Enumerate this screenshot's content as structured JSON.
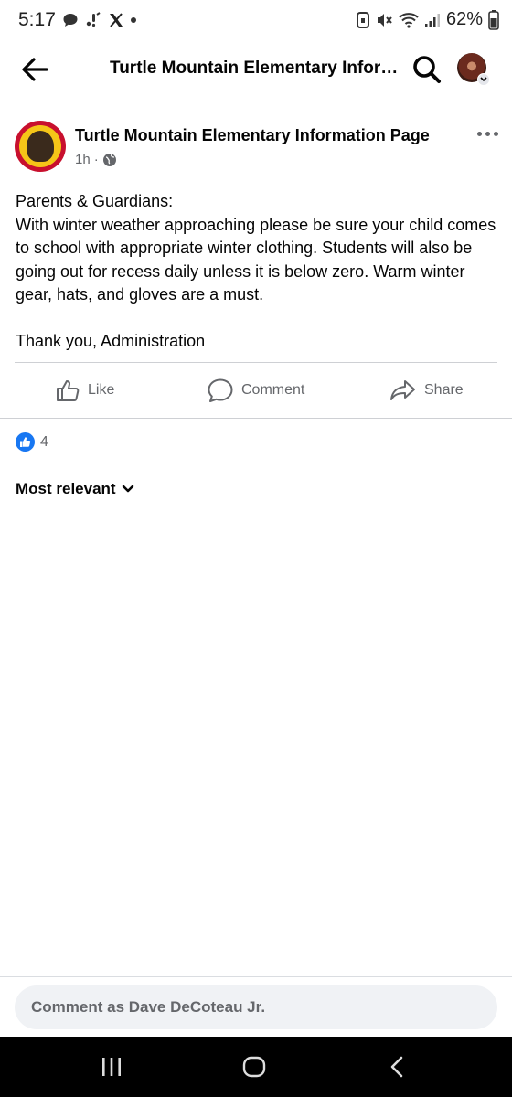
{
  "status_bar": {
    "time": "5:17",
    "battery": "62%",
    "left_icons": [
      "chat-bubble-icon",
      "notification-icon",
      "x-app-icon",
      "more-dot-icon"
    ],
    "right_icons": [
      "vibrate-lock-icon",
      "mute-icon",
      "wifi-icon",
      "signal-icon",
      "battery-icon"
    ]
  },
  "header": {
    "title": "Turtle Mountain Elementary Information Page"
  },
  "post": {
    "page_name": "Turtle Mountain Elementary Information Page",
    "time_ago": "1h",
    "privacy_separator": "·",
    "body_lines": [
      "Parents & Guardians:",
      "With winter weather approaching please be sure your child comes to school with appropriate winter clothing.  Students will also be going out for recess daily unless it is below zero. Warm winter gear, hats, and gloves are a must."
    ],
    "signoff": "Thank you, Administration"
  },
  "actions": {
    "like": "Like",
    "comment": "Comment",
    "share": "Share"
  },
  "reactions": {
    "count": "4"
  },
  "comments": {
    "sort_label": "Most relevant"
  },
  "composer": {
    "placeholder": "Comment as Dave DeCoteau Jr."
  },
  "colors": {
    "accent": "#1877f2",
    "secondary_text": "#65676b",
    "divider": "#ced0d4"
  }
}
